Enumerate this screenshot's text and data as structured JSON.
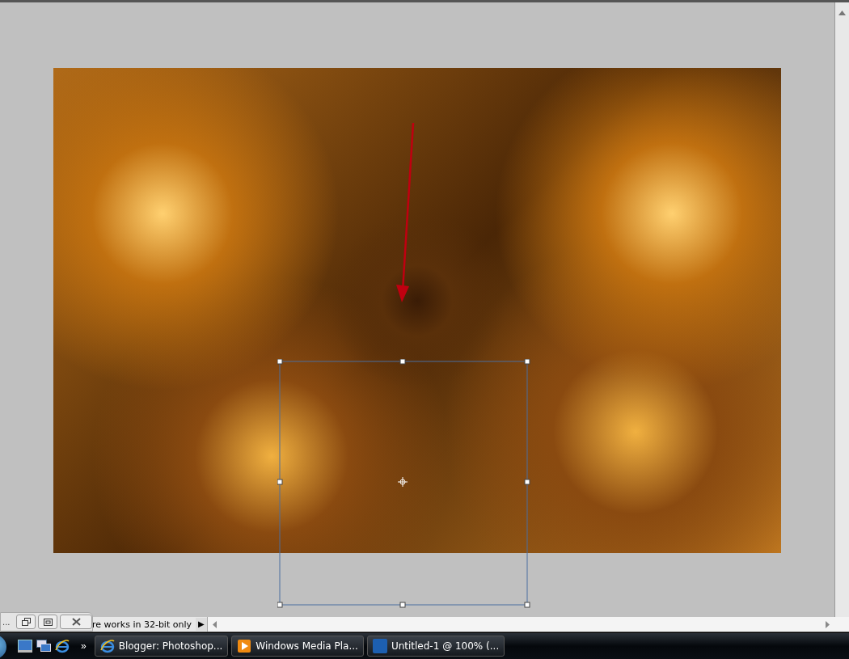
{
  "status_bar": {
    "message": "re works in 32-bit only",
    "menu_arrow": "▶"
  },
  "minimized_window": {
    "title": "..."
  },
  "taskbar": {
    "more": "»",
    "quick_launch": [
      {
        "kind": "desktop"
      },
      {
        "kind": "switch"
      },
      {
        "kind": "browser"
      }
    ],
    "tasks": [
      {
        "label": "Blogger: Photoshop...",
        "kind": "browser"
      },
      {
        "label": "Windows Media Pla...",
        "kind": "media"
      },
      {
        "label": "Untitled-1 @ 100% (...",
        "kind": "photoshop"
      }
    ]
  }
}
